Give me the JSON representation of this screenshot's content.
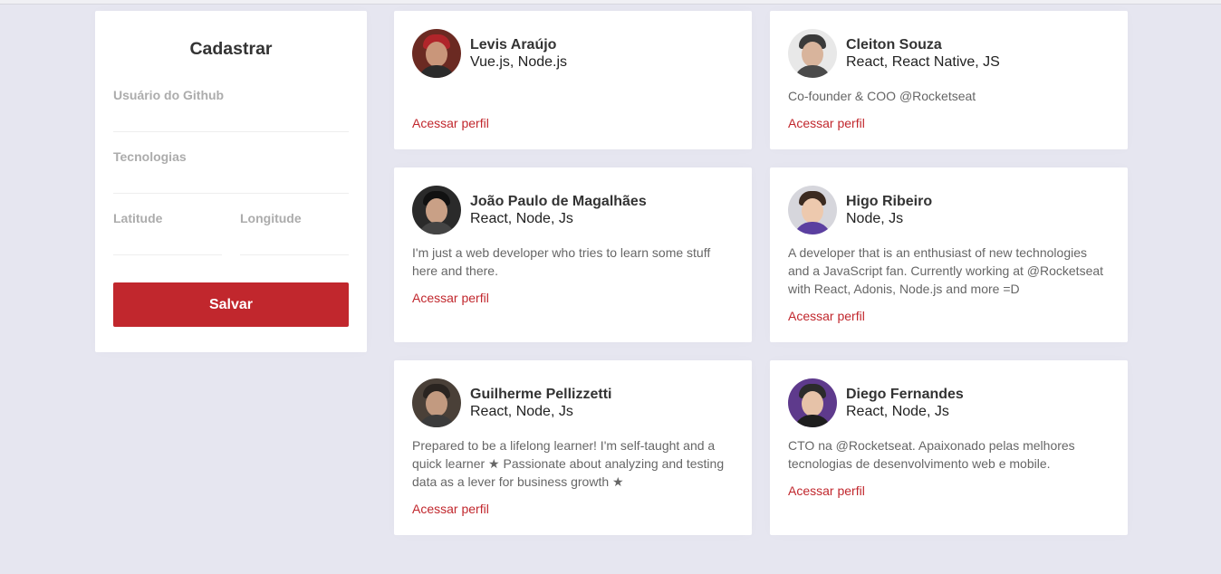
{
  "form": {
    "title": "Cadastrar",
    "github_user_placeholder": "Usuário do Github",
    "techs_placeholder": "Tecnologias",
    "latitude_placeholder": "Latitude",
    "longitude_placeholder": "Longitude",
    "save_label": "Salvar"
  },
  "colors": {
    "accent": "#c1272d",
    "background": "#e6e6f0"
  },
  "devs": [
    {
      "name": "Levis Araújo",
      "techs": "Vue.js, Node.js",
      "bio": "",
      "link_label": "Acessar perfil"
    },
    {
      "name": "Cleiton Souza",
      "techs": "React, React Native, JS",
      "bio": "Co-founder & COO @Rocketseat",
      "link_label": "Acessar perfil"
    },
    {
      "name": "João Paulo de Magalhães",
      "techs": "React, Node, Js",
      "bio": "I'm just a web developer who tries to learn some stuff here and there.",
      "link_label": "Acessar perfil"
    },
    {
      "name": "Higo Ribeiro",
      "techs": "Node, Js",
      "bio": "A developer that is an enthusiast of new technologies and a JavaScript fan. Currently working at @Rocketseat with React, Adonis, Node.js and more =D",
      "link_label": "Acessar perfil"
    },
    {
      "name": "Guilherme Pellizzetti",
      "techs": "React, Node, Js",
      "bio": "Prepared to be a lifelong learner! I'm self-taught and a quick learner ★ Passionate about analyzing and testing data as a lever for business growth ★",
      "link_label": "Acessar perfil"
    },
    {
      "name": "Diego Fernandes",
      "techs": "React, Node, Js",
      "bio": "CTO na @Rocketseat. Apaixonado pelas melhores tecnologias de desenvolvimento web e mobile.",
      "link_label": "Acessar perfil"
    }
  ]
}
